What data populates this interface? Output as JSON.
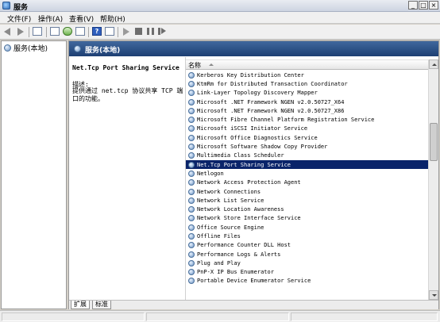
{
  "window": {
    "title": "服务",
    "controls": [
      "minimize",
      "restore",
      "close"
    ]
  },
  "menubar": {
    "items": [
      "文件(F)",
      "操作(A)",
      "查看(V)",
      "帮助(H)"
    ]
  },
  "toolbar": {
    "icons": [
      "back-icon",
      "forward-icon",
      "show-tree-icon",
      "properties-icon",
      "refresh-icon",
      "export-icon",
      "help-icon",
      "view-icon",
      "start-icon",
      "stop-icon",
      "pause-icon",
      "restart-icon"
    ]
  },
  "tree": {
    "root_label": "服务(本地)"
  },
  "content_header": {
    "title": "服务(本地)"
  },
  "description": {
    "service_name": "Net.Tcp Port Sharing Service",
    "label": "描述:",
    "text": "提供通过 net.tcp 协议共享 TCP 端口的功能。"
  },
  "list": {
    "column_name": "名称",
    "selected_index": 11,
    "rows": [
      "Kerberos Key Distribution Center",
      "KtmRm for Distributed Transaction Coordinator",
      "Link-Layer Topology Discovery Mapper",
      "Microsoft .NET Framework NGEN v2.0.50727_X64",
      "Microsoft .NET Framework NGEN v2.0.50727_X86",
      "Microsoft Fibre Channel Platform Registration Service",
      "Microsoft iSCSI Initiator Service",
      "Microsoft Office Diagnostics Service",
      "Microsoft Software Shadow Copy Provider",
      "Multimedia Class Scheduler",
      "Net.Tcp Port Sharing Service",
      "Netlogon",
      "Network Access Protection Agent",
      "Network Connections",
      "Network List Service",
      "Network Location Awareness",
      "Network Store Interface Service",
      "Office Source Engine",
      "Offline Files",
      "Performance Counter DLL Host",
      "Performance Logs & Alerts",
      "Plug and Play",
      "PnP-X IP Bus Enumerator",
      "Portable Device Enumerator Service"
    ]
  },
  "tabs": [
    "扩展",
    "标准"
  ],
  "colors": {
    "header_band": "#1d3f73",
    "selection": "#0a246a"
  }
}
